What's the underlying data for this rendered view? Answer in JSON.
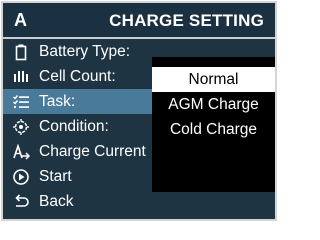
{
  "header": {
    "letter": "A",
    "title": "CHARGE SETTING"
  },
  "menu": {
    "items": [
      {
        "label": "Battery Type:",
        "icon": "battery-icon"
      },
      {
        "label": "Cell Count:",
        "icon": "cell-count-icon"
      },
      {
        "label": "Task:",
        "icon": "task-list-icon",
        "selected": true
      },
      {
        "label": "Condition:",
        "icon": "condition-gear-icon"
      },
      {
        "label": "Charge Current",
        "icon": "charge-current-icon"
      },
      {
        "label": "Start",
        "icon": "play-circle-icon"
      },
      {
        "label": "Back",
        "icon": "back-arrow-icon"
      }
    ]
  },
  "dropdown": {
    "options": [
      "Normal",
      "AGM Charge",
      "Cold Charge"
    ],
    "selected": "Normal"
  },
  "colors": {
    "background": "#1e3443",
    "highlight": "#4a7a99",
    "dropdown": "#000000"
  }
}
